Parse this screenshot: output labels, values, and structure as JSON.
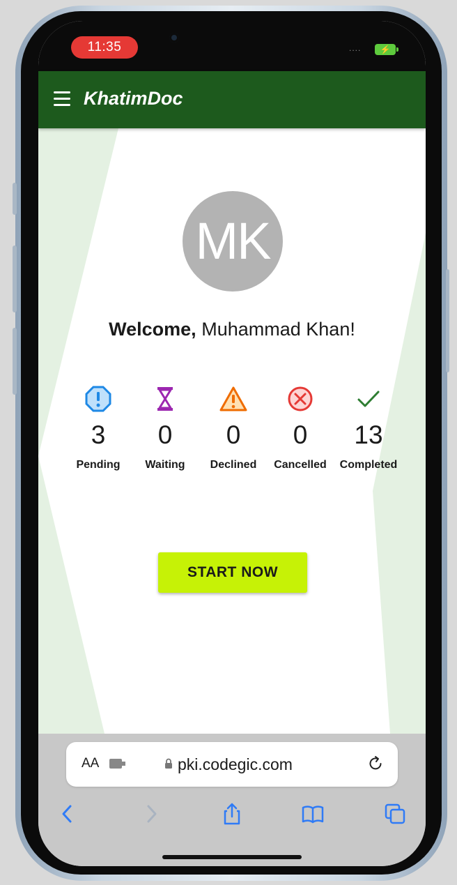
{
  "status_bar": {
    "time": "11:35",
    "signal": "....",
    "battery_icon": "charging-battery-icon",
    "time_pill_color": "#e53935",
    "battery_color": "#5ecb3d"
  },
  "app_bar": {
    "title": "KhatimDoc",
    "menu_icon": "hamburger-menu-icon",
    "color": "#1d5a1d"
  },
  "profile": {
    "initials": "MK",
    "welcome_prefix": "Welcome,",
    "user_name": "Muhammad Khan!"
  },
  "stats": [
    {
      "icon": "exclamation-octagon-icon",
      "count": "3",
      "label": "Pending",
      "color": "#1e88e5"
    },
    {
      "icon": "hourglass-icon",
      "count": "0",
      "label": "Waiting",
      "color": "#9c27b0"
    },
    {
      "icon": "warning-triangle-icon",
      "count": "0",
      "label": "Declined",
      "color": "#ef6c00"
    },
    {
      "icon": "x-circle-icon",
      "count": "0",
      "label": "Cancelled",
      "color": "#e53935"
    },
    {
      "icon": "check-icon",
      "count": "13",
      "label": "Completed",
      "color": "#2e7d32"
    }
  ],
  "start_button": {
    "label": "START NOW",
    "color": "#c6f206"
  },
  "browser": {
    "text_size_label": "AA",
    "url": "pki.codegic.com",
    "accent_color": "#2f7bf6",
    "toolbar": [
      "back-icon",
      "forward-icon",
      "share-icon",
      "bookmarks-icon",
      "tabs-icon"
    ]
  }
}
